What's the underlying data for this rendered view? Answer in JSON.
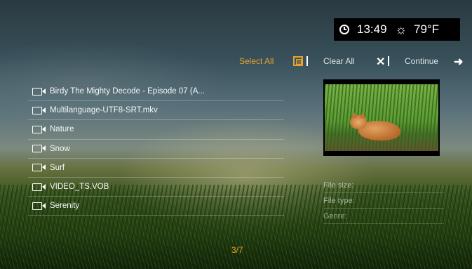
{
  "status": {
    "time": "13:49",
    "temperature": "79°F"
  },
  "toolbar": {
    "select_all": "Select All",
    "clear_all": "Clear All",
    "continue": "Continue"
  },
  "files": [
    "Birdy The Mighty Decode - Episode 07 (A...",
    "Multilanguage-UTF8-SRT.mkv",
    "Nature",
    "Snow",
    "Surf",
    "VIDEO_TS.VOB",
    "Serenity"
  ],
  "info": {
    "file_size": "File size:",
    "file_type": "File type:",
    "genre": "Genre:"
  },
  "pagination": "3/7",
  "colors": {
    "accent": "#e9a22c",
    "text": "#ffffff"
  }
}
